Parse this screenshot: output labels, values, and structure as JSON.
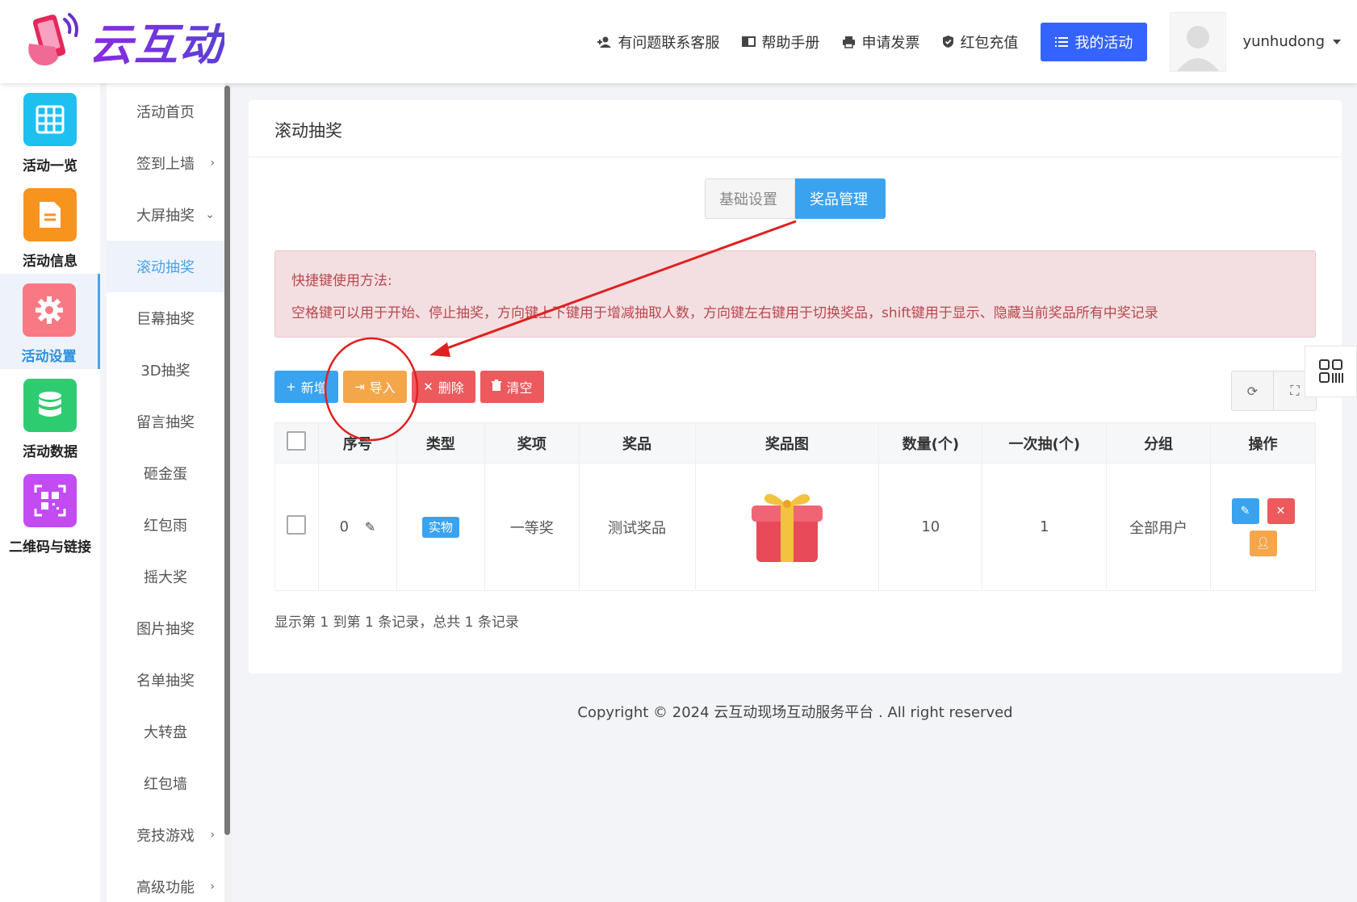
{
  "header": {
    "logo_text": "云互动",
    "links": [
      {
        "label": "有问题联系客服",
        "icon": "user-plus-icon"
      },
      {
        "label": "帮助手册",
        "icon": "book-icon"
      },
      {
        "label": "申请发票",
        "icon": "printer-icon"
      },
      {
        "label": "红包充值",
        "icon": "shield-check-icon"
      }
    ],
    "my_activity_label": "我的活动",
    "username": "yunhudong"
  },
  "icon_sidebar": {
    "items": [
      {
        "label": "活动一览",
        "icon": "grid-icon",
        "color": "#1ec0ef"
      },
      {
        "label": "活动信息",
        "icon": "document-icon",
        "color": "#f7941e"
      },
      {
        "label": "活动设置",
        "icon": "gear-icon",
        "color": "#f87983"
      },
      {
        "label": "活动数据",
        "icon": "database-icon",
        "color": "#2ecc71"
      },
      {
        "label": "二维码与链接",
        "icon": "qrcode-icon",
        "color": "#c34bf2"
      }
    ],
    "active_index": 2
  },
  "sub_menu": {
    "items": [
      {
        "label": "活动首页",
        "arrow": ""
      },
      {
        "label": "签到上墙",
        "arrow": "›"
      },
      {
        "label": "大屏抽奖",
        "arrow": "⌄"
      },
      {
        "label": "滚动抽奖",
        "arrow": ""
      },
      {
        "label": "巨幕抽奖",
        "arrow": ""
      },
      {
        "label": "3D抽奖",
        "arrow": ""
      },
      {
        "label": "留言抽奖",
        "arrow": ""
      },
      {
        "label": "砸金蛋",
        "arrow": ""
      },
      {
        "label": "红包雨",
        "arrow": ""
      },
      {
        "label": "摇大奖",
        "arrow": ""
      },
      {
        "label": "图片抽奖",
        "arrow": ""
      },
      {
        "label": "名单抽奖",
        "arrow": ""
      },
      {
        "label": "大转盘",
        "arrow": ""
      },
      {
        "label": "红包墙",
        "arrow": ""
      },
      {
        "label": "竞技游戏",
        "arrow": "›"
      },
      {
        "label": "高级功能",
        "arrow": "›"
      }
    ],
    "active_index": 3
  },
  "panel": {
    "title": "滚动抽奖",
    "tabs": [
      {
        "label": "基础设置"
      },
      {
        "label": "奖品管理"
      }
    ],
    "alert": {
      "title": "快捷键使用方法:",
      "body": "空格键可以用于开始、停止抽奖，方向键上下键用于增减抽取人数，方向键左右键用于切换奖品，shift键用于显示、隐藏当前奖品所有中奖记录"
    },
    "toolbar": {
      "add": "新增",
      "import": "导入",
      "delete": "删除",
      "clear": "清空"
    },
    "table": {
      "headers": [
        "序号",
        "类型",
        "奖项",
        "奖品",
        "奖品图",
        "数量(个)",
        "一次抽(个)",
        "分组",
        "操作"
      ],
      "rows": [
        {
          "index": "0",
          "type": "实物",
          "award": "一等奖",
          "prize": "测试奖品",
          "image": "gift-box-icon",
          "quantity": "10",
          "per_draw": "1",
          "group": "全部用户"
        }
      ]
    },
    "pager_text": "显示第 1 到第 1 条记录，总共 1 条记录"
  },
  "footer": {
    "copyright": "Copyright © 2024 云互动现场互动服务平台 . All right reserved"
  },
  "colors": {
    "primary": "#3463ff",
    "info": "#3aa3ef",
    "warning": "#f4a64b",
    "danger": "#ec5a5e",
    "annotation": "#e02020"
  }
}
